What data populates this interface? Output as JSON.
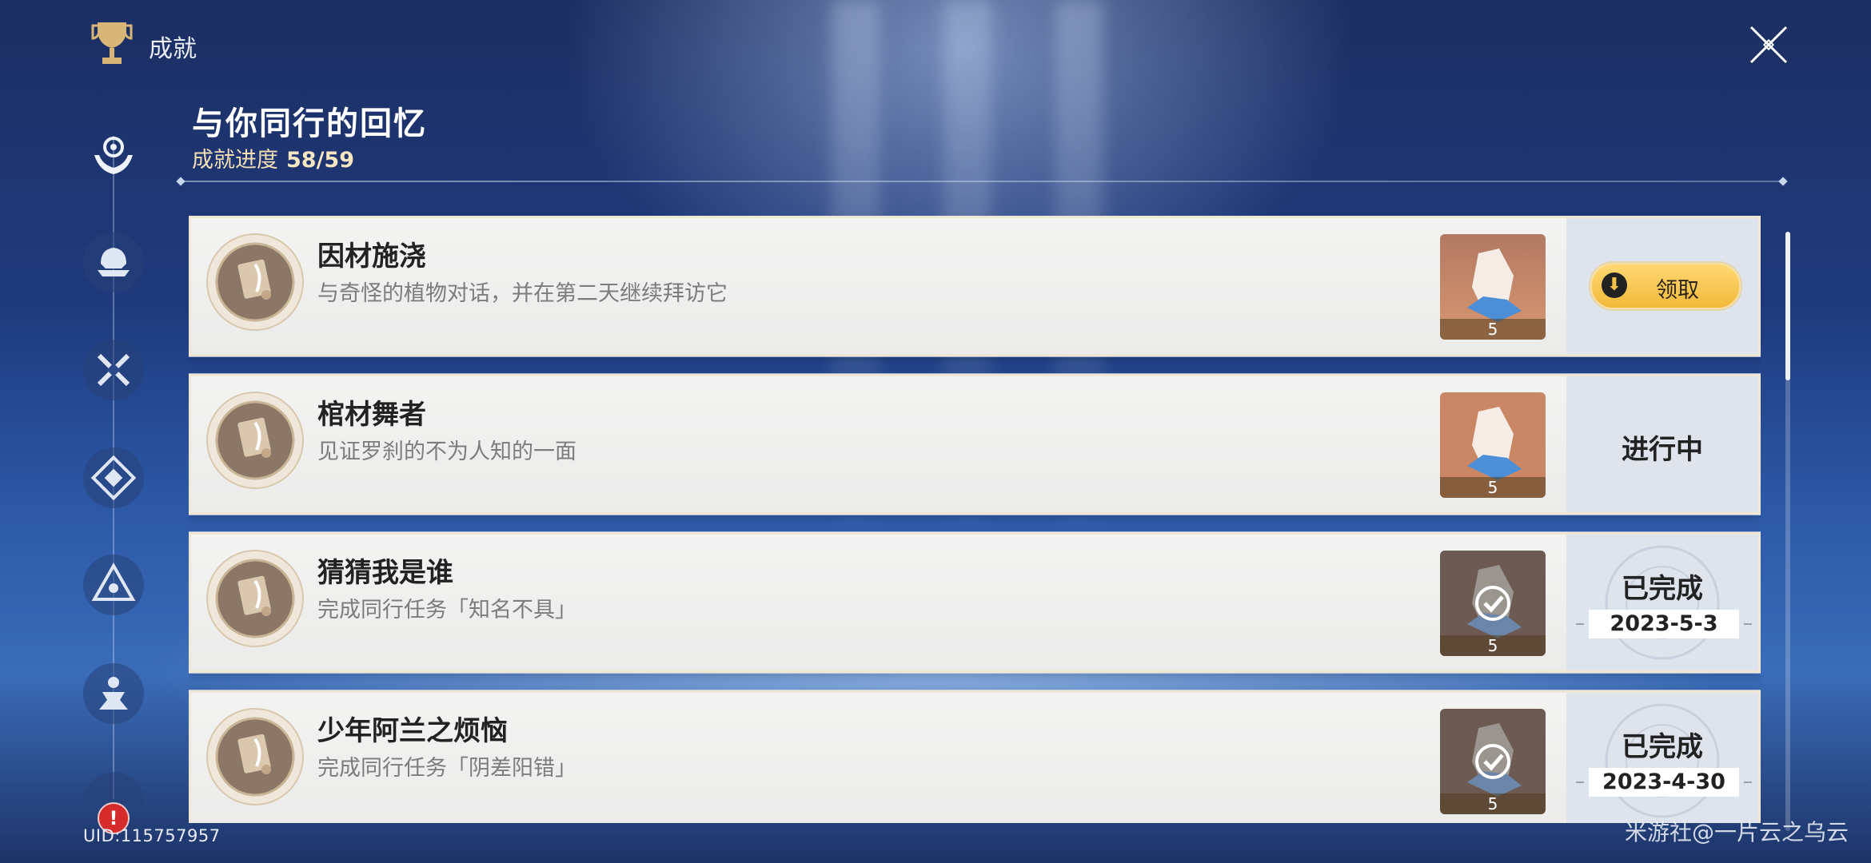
{
  "header": {
    "section_title": "成就",
    "page_title": "与你同行的回忆",
    "progress_label": "成就进度",
    "progress_value": "58/59"
  },
  "sidebar": {
    "uid": "UID:115757957",
    "items": [
      {
        "icon": "hands-gear-icon",
        "active": true
      },
      {
        "icon": "helmet-icon",
        "active": false
      },
      {
        "icon": "crossed-weapons-icon",
        "active": false
      },
      {
        "icon": "diamond-emblem-icon",
        "active": false
      },
      {
        "icon": "triangle-emblem-icon",
        "active": false
      },
      {
        "icon": "figure-emblem-icon",
        "active": false
      }
    ]
  },
  "achievements": [
    {
      "title": "因材施浇",
      "description": "与奇怪的植物对话，并在第二天继续拜访它",
      "reward_count": "5",
      "status": "claim",
      "claim_label": "领取"
    },
    {
      "title": "棺材舞者",
      "description": "见证罗刹的不为人知的一面",
      "reward_count": "5",
      "status": "in_progress",
      "status_label": "进行中"
    },
    {
      "title": "猜猜我是谁",
      "description": "完成同行任务「知名不具」",
      "reward_count": "5",
      "status": "completed",
      "status_label": "已完成",
      "date": "2023-5-3"
    },
    {
      "title": "少年阿兰之烦恼",
      "description": "完成同行任务「阴差阳错」",
      "reward_count": "5",
      "status": "completed",
      "status_label": "已完成",
      "date": "2023-4-30"
    }
  ],
  "watermark": "米游社@一片云之乌云",
  "colors": {
    "accent_gold": "#f2b93a",
    "progress_text": "#f2dfb6",
    "card_bg": "#f1f1f0",
    "status_panel": "#dfe3ec"
  }
}
